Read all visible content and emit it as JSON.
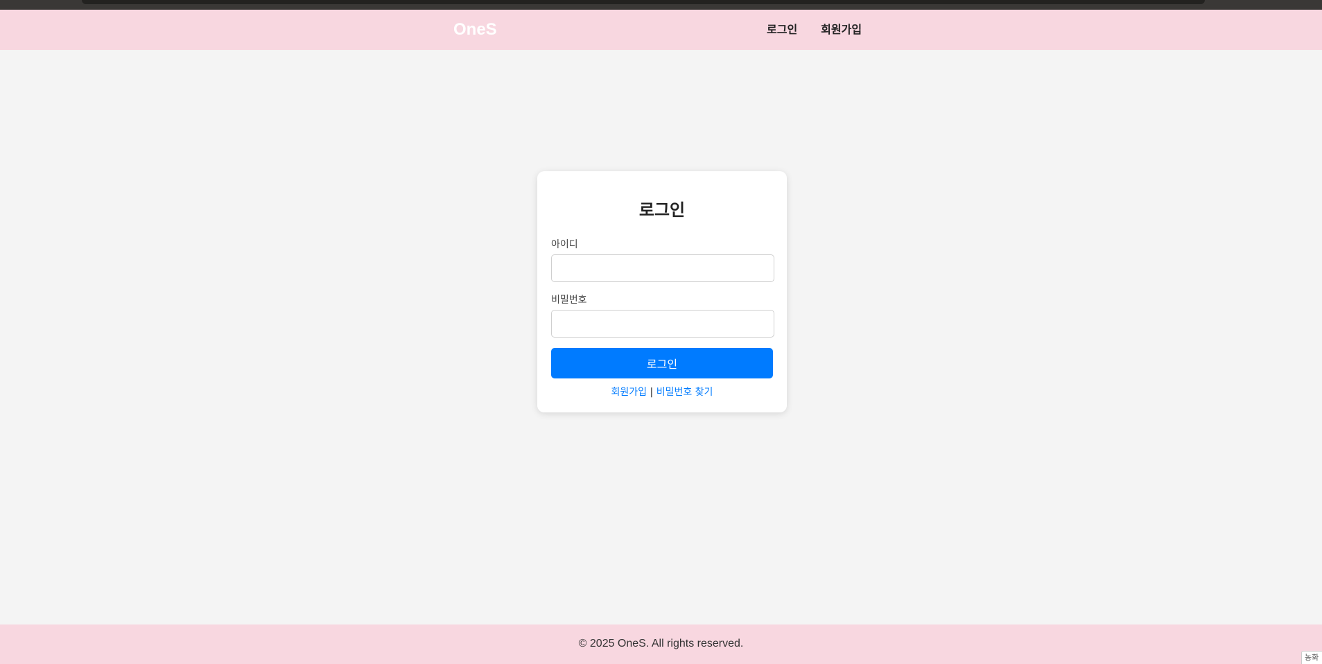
{
  "header": {
    "logo": "OneS",
    "nav": {
      "login": "로그인",
      "signup": "회원가입"
    }
  },
  "login_form": {
    "title": "로그인",
    "id_label": "아이디",
    "id_value": "",
    "password_label": "비밀번호",
    "password_value": "",
    "submit_label": "로그인",
    "signup_link": "회원가입",
    "separator": "|",
    "find_password_link": "비밀번호 찾기"
  },
  "footer": {
    "copyright": "© 2025 OneS. All rights reserved."
  },
  "corner_widget": {
    "label": "농화"
  },
  "colors": {
    "header_bg": "#f8d7e0",
    "page_bg": "#f4f4f4",
    "primary": "#007bff"
  }
}
